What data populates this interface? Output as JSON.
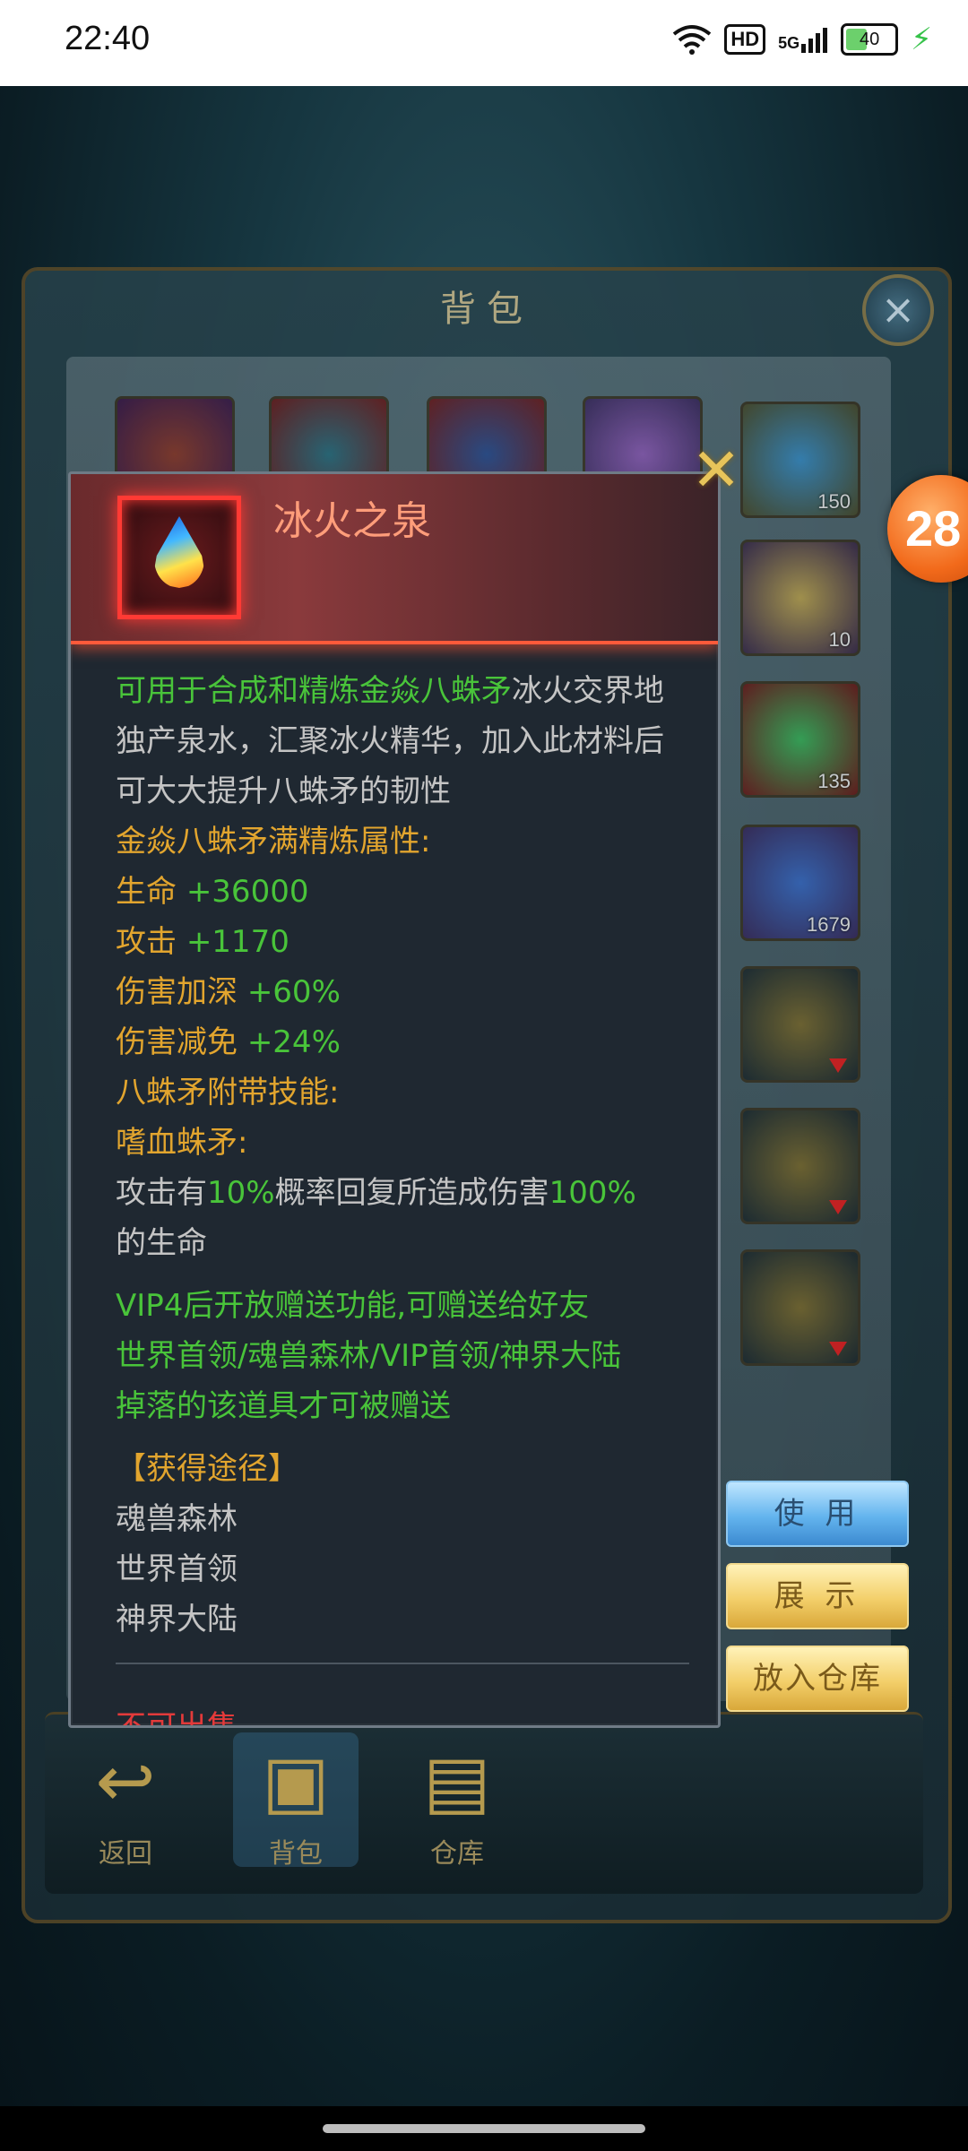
{
  "status_bar": {
    "time": "22:40",
    "hd": "HD",
    "network": "5G",
    "battery": "40",
    "icons": [
      "wifi-icon",
      "hd-icon",
      "signal-icon",
      "battery-icon",
      "charging-icon"
    ]
  },
  "bag": {
    "title": "背包",
    "slot_counts": [
      "150",
      "10",
      "135",
      "1679"
    ],
    "nav": [
      {
        "label": "返回",
        "icon": "return-icon"
      },
      {
        "label": "背包",
        "icon": "bag-icon"
      },
      {
        "label": "仓库",
        "icon": "warehouse-icon"
      }
    ]
  },
  "float_badge": "28",
  "item": {
    "name": "冰火之泉",
    "icon": "water-drop-icon",
    "desc_green": "可用于合成和精炼金焱八蛛矛",
    "desc_gray": "冰火交界地独产泉水，汇聚冰火精华，加入此材料后可大大提升八蛛矛的韧性",
    "refine_header": "金焱八蛛矛满精炼属性:",
    "stats": [
      {
        "label": "生命",
        "value": "+36000"
      },
      {
        "label": "攻击",
        "value": "+1170"
      },
      {
        "label": "伤害加深",
        "value": "+60%"
      },
      {
        "label": "伤害减免",
        "value": "+24%"
      }
    ],
    "skill_header": "八蛛矛附带技能:",
    "skill_name": "嗜血蛛矛:",
    "skill_desc": {
      "part1": "攻击有",
      "pct1": "10%",
      "part2": "概率回复所造成伤害",
      "pct2": "100%",
      "part3": "的生命"
    },
    "gift_lines": [
      "VIP4后开放赠送功能,可赠送给好友",
      "世界首领/魂兽森林/VIP首领/神界大陆",
      "掉落的该道具才可被赠送"
    ],
    "source_header": "【获得途径】",
    "sources": [
      "魂兽森林",
      "世界首领",
      "神界大陆"
    ],
    "sell_note": "不可出售"
  },
  "buttons": {
    "use": "使 用",
    "show": "展 示",
    "store": "放入仓库"
  },
  "colors": {
    "green_text": "#49c43a",
    "gold_text": "#e2a52e",
    "name_text": "#ff9d7a",
    "red_frame": "#ff3a34"
  }
}
